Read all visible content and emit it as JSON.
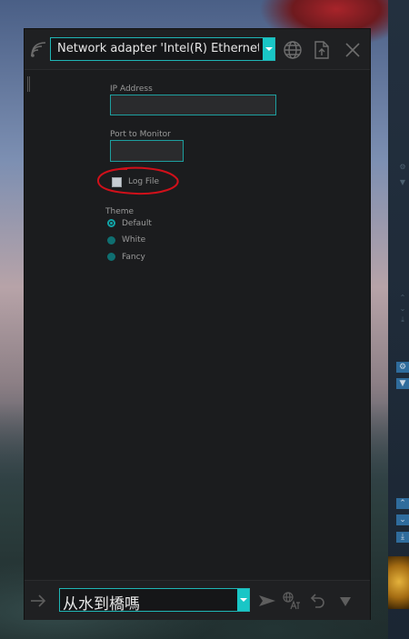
{
  "window": {
    "adapter_select": "Network adapter 'Intel(R) Ethernet Connection'",
    "ip_label": "IP Address",
    "ip_value": "",
    "port_label": "Port to Monitor",
    "port_value": "",
    "log_file_label": "Log File",
    "log_file_checked": false,
    "theme_label": "Theme",
    "theme_options": [
      {
        "label": "Default",
        "selected": true
      },
      {
        "label": "White",
        "selected": false
      },
      {
        "label": "Fancy",
        "selected": false
      }
    ],
    "message_input": "从水到橋嗎"
  },
  "icons": {
    "titlebar": [
      "wifi-icon",
      "globe-icon",
      "export-icon",
      "close-icon"
    ],
    "bottombar": [
      "arrow-right-icon",
      "send-icon",
      "translate-icon",
      "undo-icon",
      "triangle-down-icon"
    ],
    "side_panel": [
      "gear-icon",
      "filter-icon",
      "chevron-up-icon",
      "chevron-down-icon",
      "skip-down-icon"
    ]
  },
  "colors": {
    "accent": "#19c6c6",
    "window_bg": "#1b1c1e",
    "annotation": "#d0101a"
  }
}
